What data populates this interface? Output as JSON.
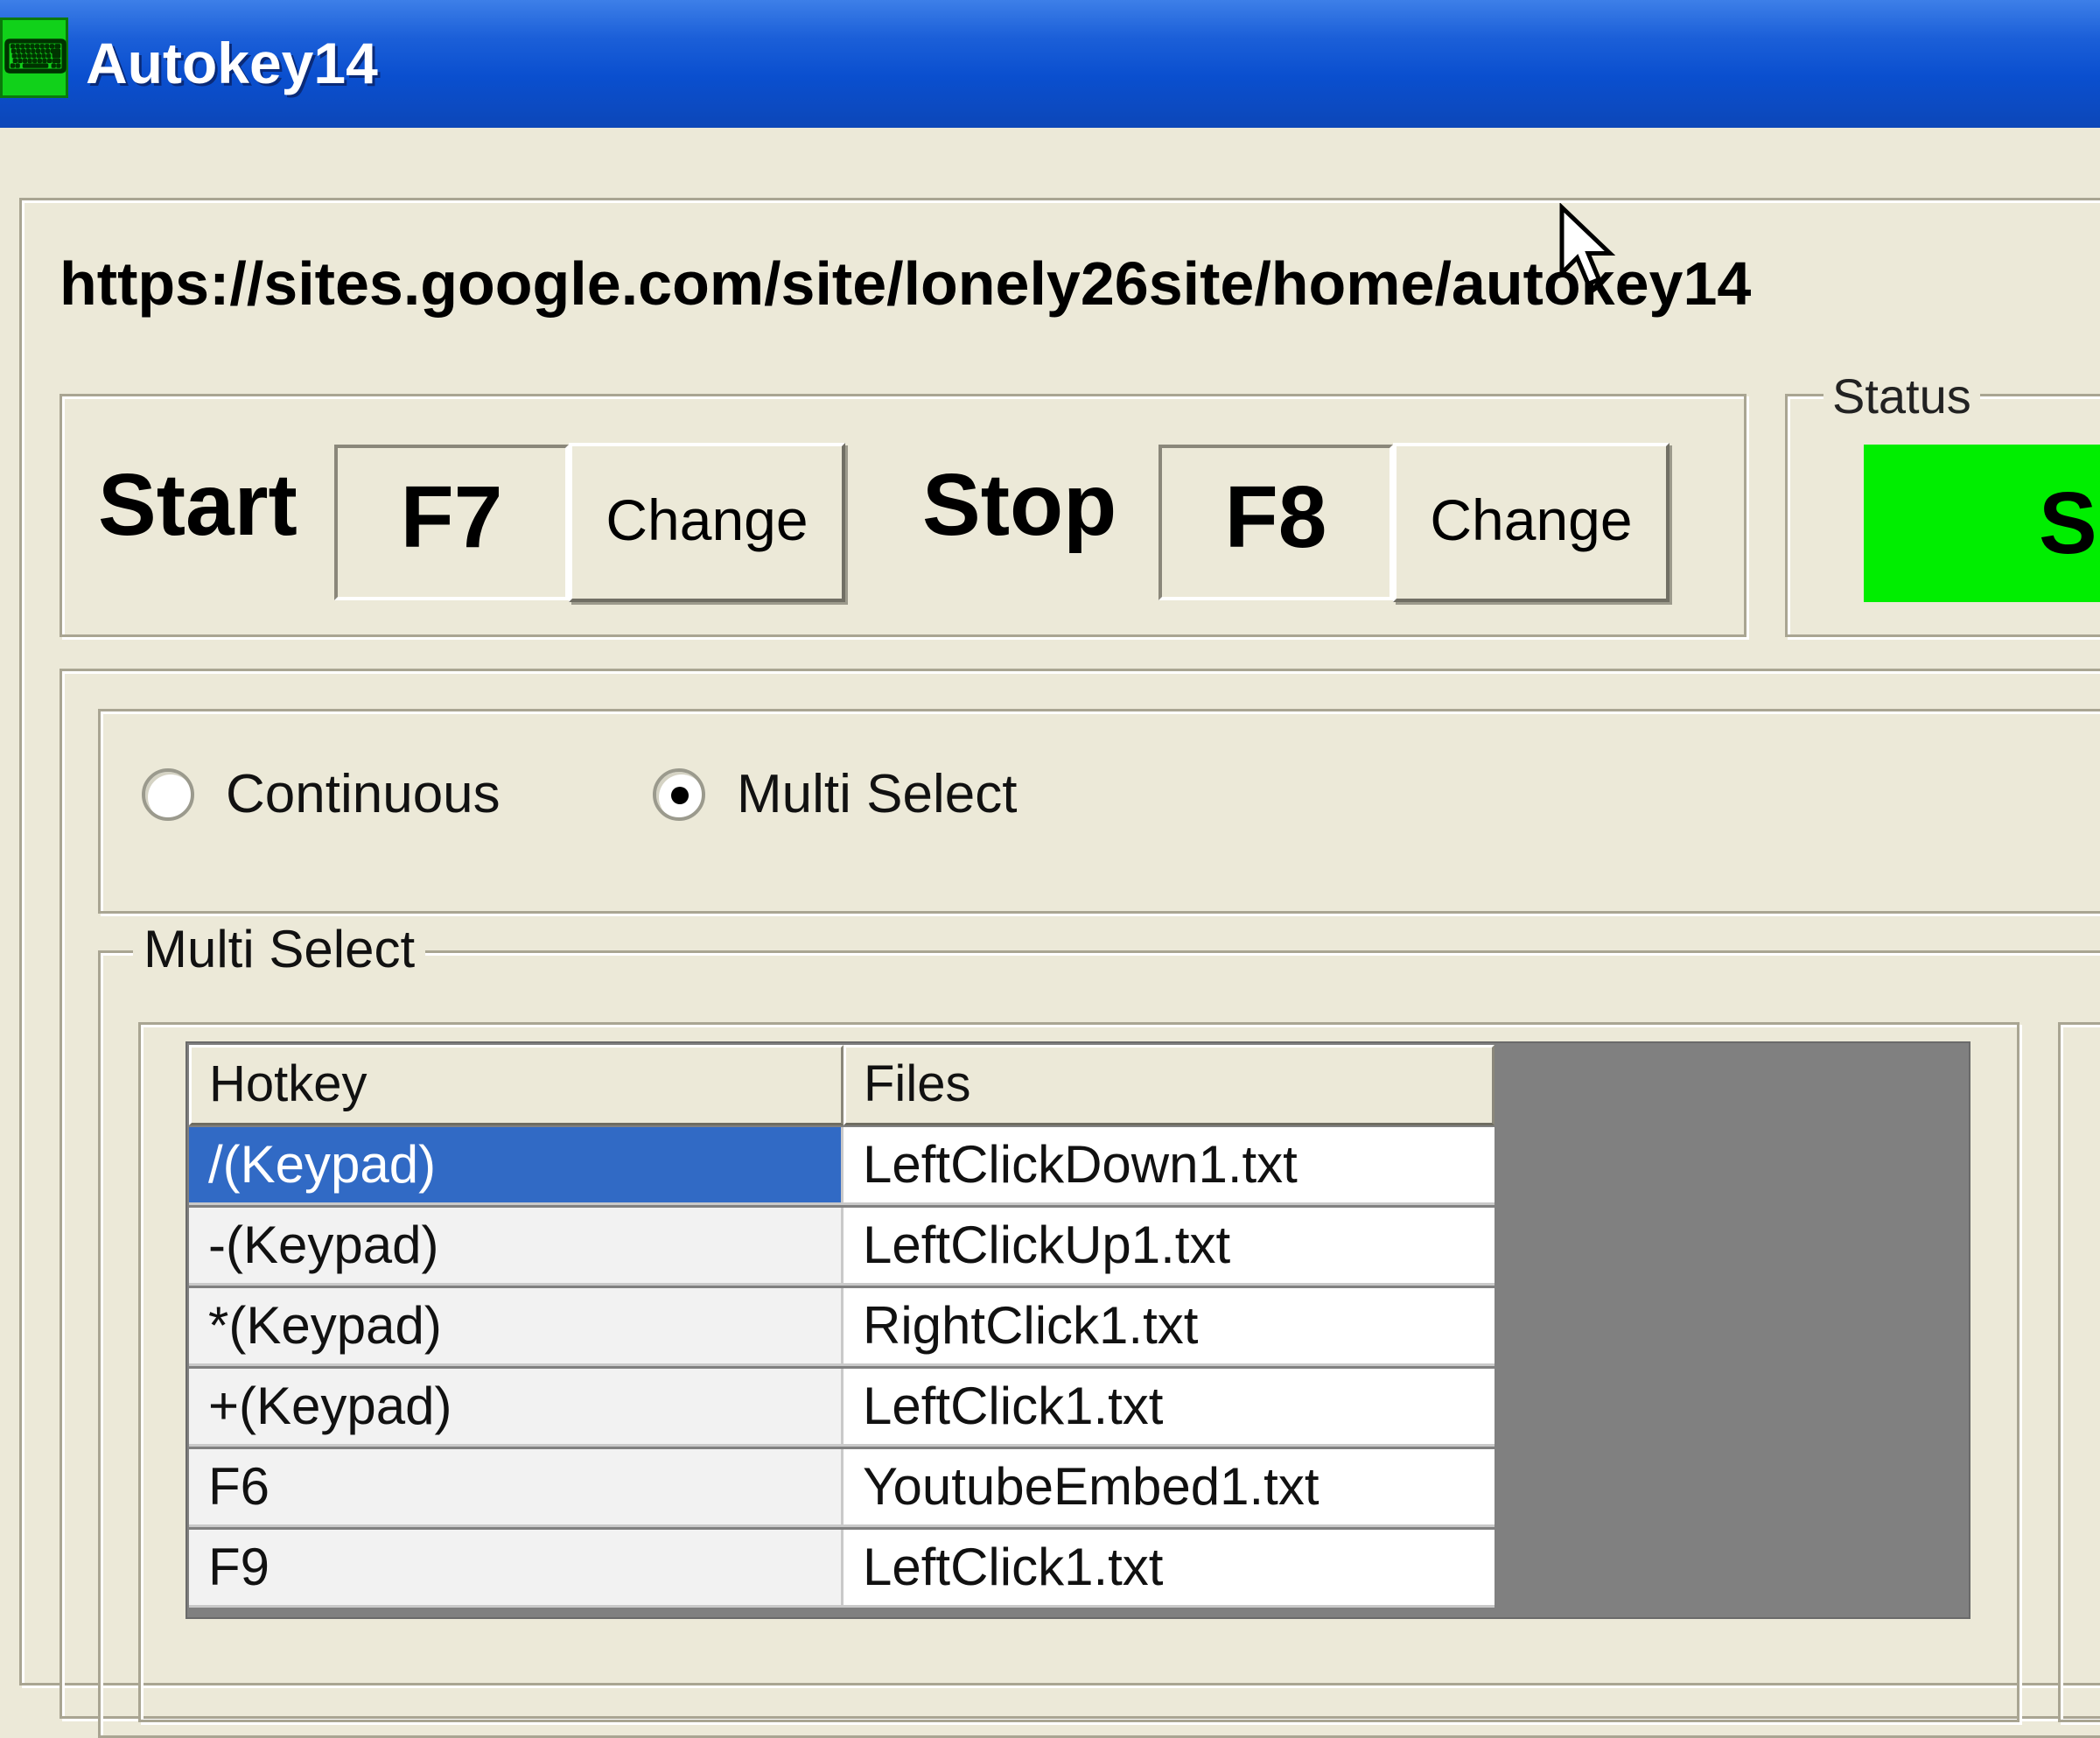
{
  "window": {
    "title": "Autokey14",
    "icon": "autokey-app-icon",
    "icon_glyph": "⌨"
  },
  "site_url": "https://sites.google.com/site/lonely26site/home/autokey14",
  "hotkeys": {
    "start_label": "Start",
    "start_key": "F7",
    "start_change": "Change",
    "stop_label": "Stop",
    "stop_key": "F8",
    "stop_change": "Change"
  },
  "status": {
    "legend": "Status",
    "indicator_text": "S",
    "indicator_color": "#00ee00"
  },
  "mode": {
    "continuous_label": "Continuous",
    "continuous_checked": false,
    "multi_label": "Multi Select",
    "multi_checked": true
  },
  "multi_select": {
    "legend": "Multi Select",
    "columns": [
      "Hotkey",
      "Files"
    ],
    "rows": [
      {
        "hotkey": "/(Keypad)",
        "file": "LeftClickDown1.txt",
        "selected": true
      },
      {
        "hotkey": "-(Keypad)",
        "file": "LeftClickUp1.txt",
        "selected": false
      },
      {
        "hotkey": "*(Keypad)",
        "file": "RightClick1.txt",
        "selected": false
      },
      {
        "hotkey": "+(Keypad)",
        "file": "LeftClick1.txt",
        "selected": false
      },
      {
        "hotkey": "F6",
        "file": "YoutubeEmbed1.txt",
        "selected": false
      },
      {
        "hotkey": "F9",
        "file": "LeftClick1.txt",
        "selected": false
      }
    ]
  },
  "colors": {
    "titlebar": "#0a4fcf",
    "selection": "#316ac5",
    "window_bg": "#ece9d8"
  }
}
